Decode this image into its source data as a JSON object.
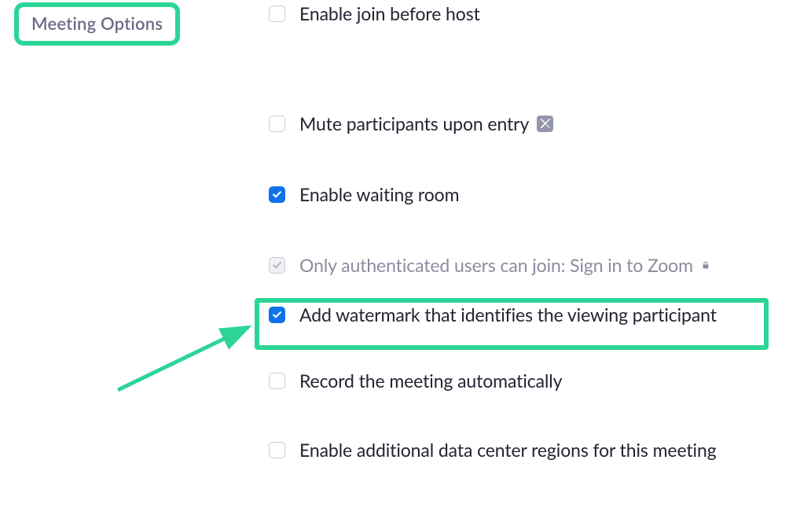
{
  "section_title": "Meeting Options",
  "options": {
    "join_before_host": {
      "label": "Enable join before host",
      "checked": false,
      "locked": false,
      "badge": false
    },
    "mute_on_entry": {
      "label": "Mute participants upon entry",
      "checked": false,
      "locked": false,
      "badge": true
    },
    "waiting_room": {
      "label": "Enable waiting room",
      "checked": true,
      "locked": false,
      "badge": false
    },
    "auth_users": {
      "label": "Only authenticated users can join: Sign in to Zoom",
      "checked": true,
      "locked": true,
      "badge": false
    },
    "watermark": {
      "label": "Add watermark that identifies the viewing participant",
      "checked": true,
      "locked": false,
      "badge": false
    },
    "auto_record": {
      "label": "Record the meeting automatically",
      "checked": false,
      "locked": false,
      "badge": false
    },
    "data_centers": {
      "label": "Enable additional data center regions for this meeting",
      "checked": false,
      "locked": false,
      "badge": false
    }
  },
  "annotations": {
    "highlight_color": "#2cd597"
  }
}
